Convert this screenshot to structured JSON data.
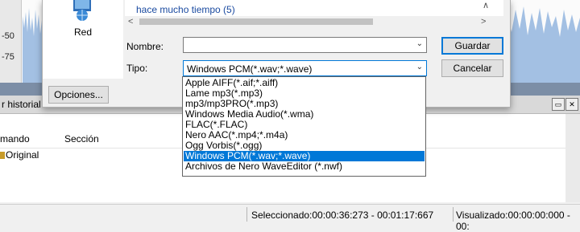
{
  "editor": {
    "ruler_labels": [
      "-50",
      "-75"
    ],
    "history_title": "r historial",
    "history_columns": [
      "mando",
      "Sección"
    ],
    "history_row": "Original",
    "status_selected": "Seleccionado:00:00:36:273 - 00:01:17:667",
    "status_visible": "Visualizado:00:00:00:000 - 00:"
  },
  "dialog": {
    "nav_pane_item": "Red",
    "partial_file_item": "hace mucho tiempo (5)",
    "filename_label": "Nombre:",
    "filename_value": "",
    "type_label": "Tipo:",
    "type_value": "Windows PCM(*.wav;*.wave)",
    "save_button": "Guardar",
    "cancel_button": "Cancelar",
    "options_button": "Opciones...",
    "type_options": [
      "Apple AIFF(*.aif;*.aiff)",
      "Lame mp3(*.mp3)",
      "mp3/mp3PRO(*.mp3)",
      "Windows Media Audio(*.wma)",
      "FLAC(*.FLAC)",
      "Nero AAC(*.mp4;*.m4a)",
      "Ogg Vorbis(*.ogg)",
      "Windows PCM(*.wav;*.wave)",
      "Archivos de Nero WaveEditor (*.nwf)"
    ],
    "selected_index": 7
  },
  "colors": {
    "accent": "#0078d7",
    "waveform": "#5b8fcf"
  }
}
